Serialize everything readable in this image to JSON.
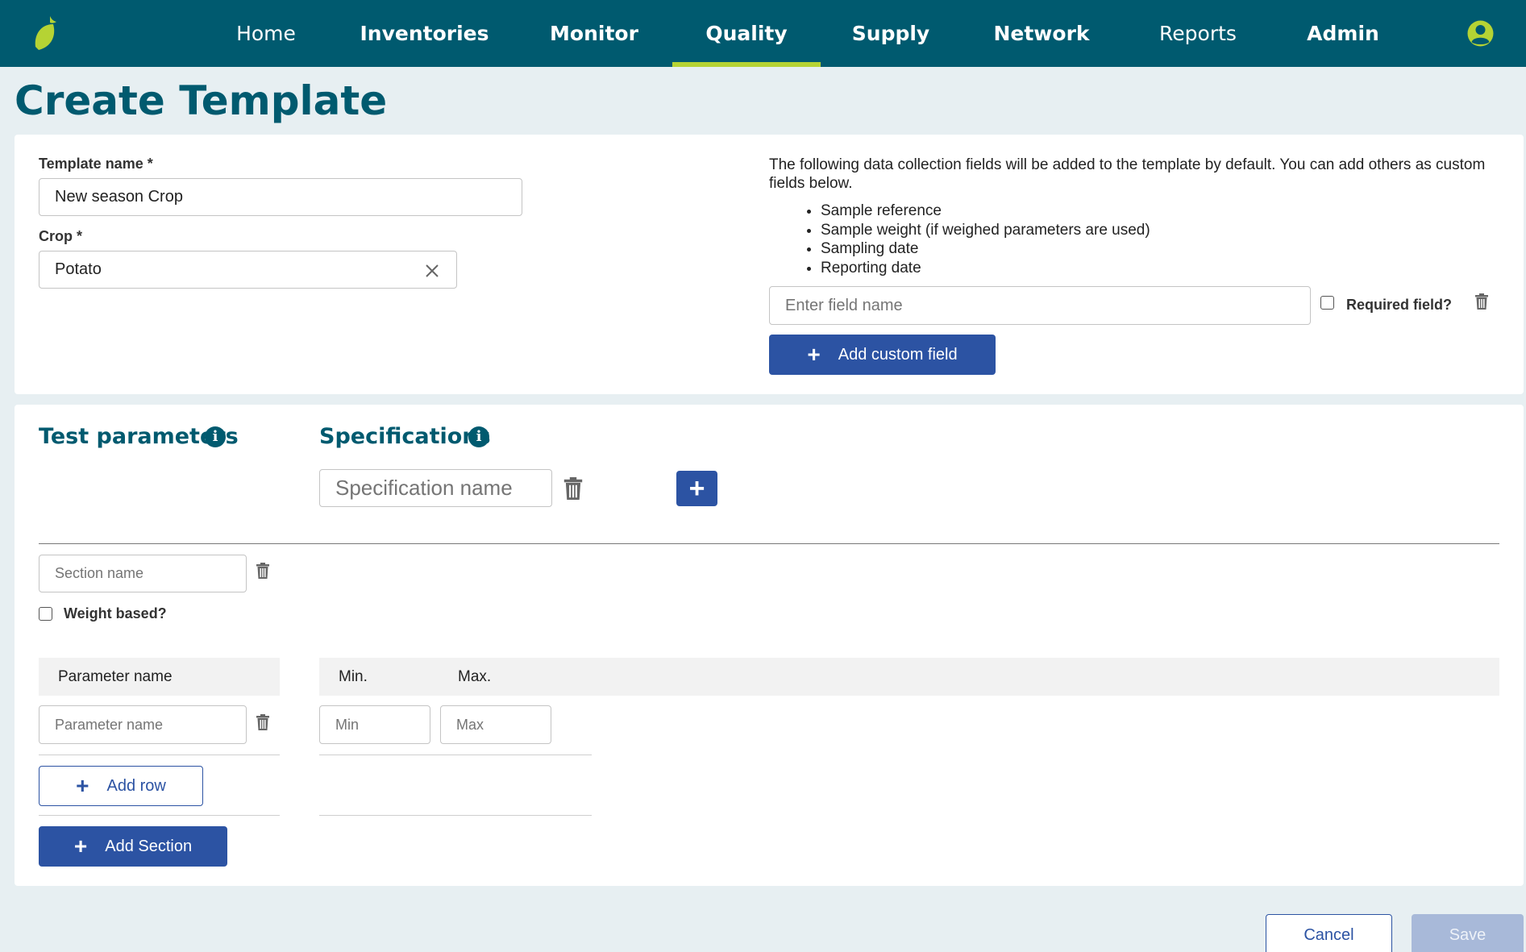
{
  "nav": {
    "items": [
      {
        "label": "Home",
        "bold": false,
        "active": false
      },
      {
        "label": "Inventories",
        "bold": true,
        "active": false
      },
      {
        "label": "Monitor",
        "bold": true,
        "active": false
      },
      {
        "label": "Quality",
        "bold": true,
        "active": true
      },
      {
        "label": "Supply",
        "bold": true,
        "active": false
      },
      {
        "label": "Network",
        "bold": true,
        "active": false
      },
      {
        "label": "Reports",
        "bold": false,
        "active": false
      },
      {
        "label": "Admin",
        "bold": true,
        "active": false
      }
    ],
    "logo_icon": "leaf-icon",
    "user_icon": "user-circle-icon"
  },
  "page_title": "Create Template",
  "template": {
    "name_label": "Template name *",
    "name_value": "New season Crop",
    "crop_label": "Crop *",
    "crop_value": "Potato"
  },
  "default_fields": {
    "intro": "The following data collection fields will be added to the template by default. You can add others as custom fields below.",
    "items": [
      "Sample reference",
      "Sample weight (if weighed parameters are used)",
      "Sampling date",
      "Reporting date"
    ]
  },
  "custom_field": {
    "placeholder": "Enter field name",
    "required_label": "Required field?",
    "required_checked": false,
    "add_label": "Add custom field"
  },
  "test_parameters": {
    "title": "Test parameters",
    "section_placeholder": "Section name",
    "weight_based_label": "Weight based?",
    "weight_based_checked": false,
    "column_header": "Parameter name",
    "parameter_placeholder": "Parameter name",
    "add_row_label": "Add row",
    "add_section_label": "Add Section"
  },
  "specifications": {
    "title": "Specifications",
    "name_placeholder": "Specification name",
    "min_header": "Min.",
    "max_header": "Max.",
    "min_placeholder": "Min",
    "max_placeholder": "Max"
  },
  "footer": {
    "cancel_label": "Cancel",
    "save_label": "Save"
  },
  "colors": {
    "nav_bg": "#005a6f",
    "active_underline": "#b5d334",
    "primary": "#2c53a3",
    "title": "#005a6f"
  }
}
